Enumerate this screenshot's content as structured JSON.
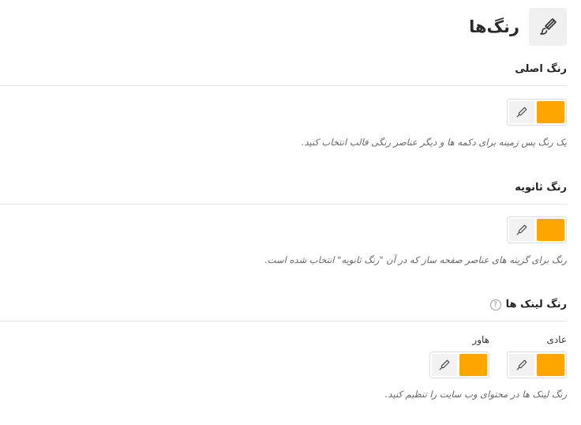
{
  "header": {
    "title": "رنگ‌ها",
    "icon": "brush-icon"
  },
  "primary": {
    "title": "رنگ اصلی",
    "color": "#ffa500",
    "description": "یک رنگ پس زمینه برای دکمه ها و دیگر عناصر رنگی قالب انتخاب کنید."
  },
  "secondary": {
    "title": "رنگ ثانویه",
    "color": "#ffa500",
    "description": "رنگ برای گزینه های عناصر صفحه ساز که در آن \"رنگ ثانویه\" انتخاب شده است."
  },
  "links": {
    "title": "رنگ لینک ها",
    "help": "?",
    "normal_label": "عادی",
    "hover_label": "هاور",
    "normal_color": "#ffa500",
    "hover_color": "#ffa500",
    "description": "رنگ لینک ها در محتوای وب سایت را تنظیم کنید."
  }
}
